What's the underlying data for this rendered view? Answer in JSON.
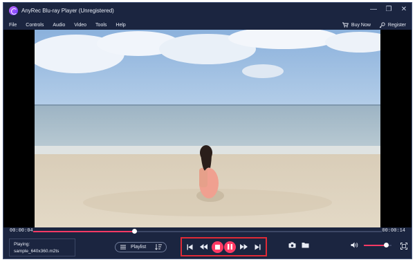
{
  "window": {
    "title": "AnyRec Blu-ray Player (Unregistered)",
    "controls": [
      "minimize-icon",
      "restore-icon",
      "close-icon"
    ]
  },
  "menu": {
    "items": [
      "File",
      "Controls",
      "Audio",
      "Video",
      "Tools",
      "Help"
    ],
    "buy_now": "Buy Now",
    "register": "Register"
  },
  "player": {
    "elapsed": "00:00:04",
    "total": "00:00:14",
    "progress": 0.29,
    "playing_label": "Playing:",
    "file_name": "sample_640x360.m2ts",
    "playlist_label": "Playlist",
    "volume": 0.8
  },
  "colors": {
    "accent": "#ff3a64",
    "highlight_box": "#e02a36",
    "background": "#1b2540"
  }
}
